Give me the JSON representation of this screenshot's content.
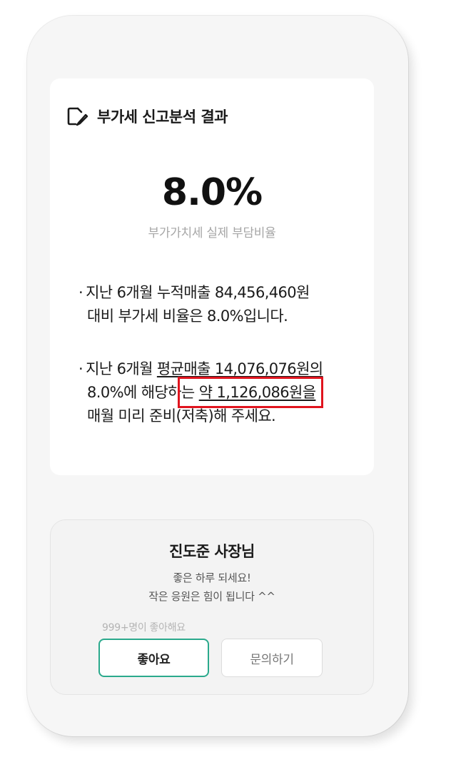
{
  "report": {
    "title": "부가세 신고분석 결과",
    "title_icon": "edit-document-icon",
    "ratio_value": "8.0%",
    "ratio_caption": "부가가치세 실제 부담비율",
    "bullet1": {
      "line1": "지난 6개월 누적매출 84,456,460원",
      "line2": "대비 부가세 비율은 8.0%입니다."
    },
    "bullet2": {
      "line1_pre": "지난 6개월 ",
      "line1_underlined": "평균매출 14,076,076원의",
      "line2_pre": "8.0%에 해당하는 ",
      "line2_highlight": "약 1,126,086원을",
      "line3": "매월 미리 준비(저축)해 주세요."
    },
    "bullet_marker": "·"
  },
  "highlight": {
    "color": "#e0141e"
  },
  "owner": {
    "name": "진도준 사장님",
    "message_line1": "좋은 하루 되세요!",
    "message_line2": "작은 응원은 힘이 됩니다 ^^",
    "like_count": "999+명이 좋아해요",
    "like_button": "좋아요",
    "inquiry_button": "문의하기",
    "accent_color": "#2aa98c"
  }
}
